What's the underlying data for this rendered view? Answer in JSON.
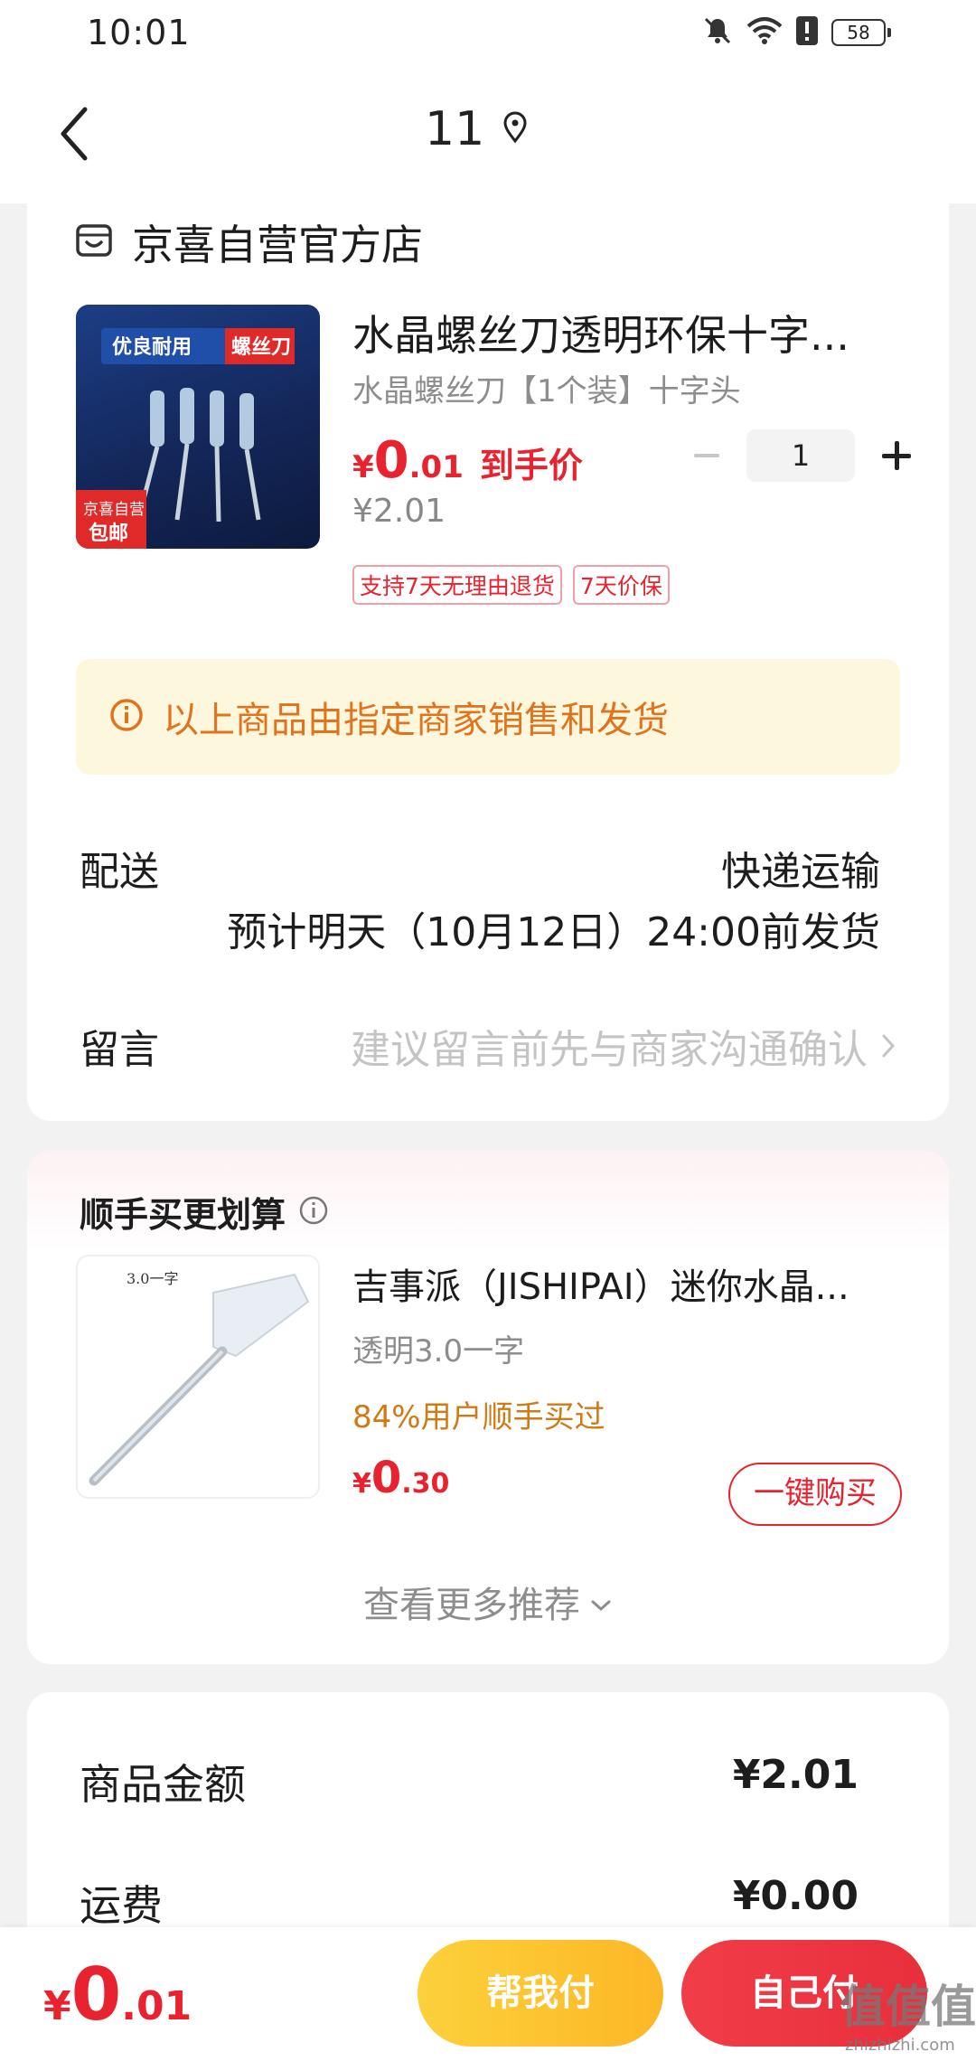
{
  "status_bar": {
    "time": "10:01",
    "battery": "58",
    "icons": [
      "mute-bell-icon",
      "wifi-icon",
      "alert-icon",
      "battery-icon"
    ]
  },
  "header": {
    "title": "11",
    "icons": [
      "back-icon",
      "location-icon"
    ]
  },
  "store": {
    "name": "京喜自营官方店"
  },
  "product": {
    "title": "水晶螺丝刀透明环保十字...",
    "spec": "水晶螺丝刀【1个装】十字头",
    "price_symbol": "¥",
    "price_int": "0",
    "price_dec": ".01",
    "price_tag": "到手价",
    "original_price": "¥2.01",
    "quantity": "1",
    "tags": [
      "支持7天无理由退货",
      "7天价保"
    ],
    "image": {
      "banner_left": "优良耐用",
      "banner_right": "螺丝刀",
      "badge_top": "京喜自营",
      "badge_bottom": "包邮"
    }
  },
  "notice": {
    "text": "以上商品由指定商家销售和发货"
  },
  "delivery": {
    "label": "配送",
    "method": "快递运输",
    "estimate": "预计明天（10月12日）24:00前发货"
  },
  "message": {
    "label": "留言",
    "placeholder": "建议留言前先与商家沟通确认"
  },
  "recommend": {
    "title": "顺手买更划算",
    "item": {
      "name": "吉事派（JISHIPAI）迷你水晶...",
      "spec": "透明3.0一字",
      "social": "84%用户顺手买过",
      "price_symbol": "¥",
      "price_int": "0",
      "price_dec": ".30",
      "buy_label": "一键购买",
      "image_label": "3.0一字"
    },
    "more": "查看更多推荐"
  },
  "summary": {
    "goods_label": "商品金额",
    "goods_value": "¥2.01",
    "shipping_label": "运费",
    "shipping_value": "¥0.00"
  },
  "bottom": {
    "total_symbol": "¥",
    "total_int": "0",
    "total_dec": ".01",
    "help_pay": "帮我付",
    "self_pay": "自己付"
  },
  "watermark": {
    "main": "值值值",
    "sub": "zhizhizhi.com"
  },
  "colors": {
    "accent_red": "#e8232f",
    "notice_bg": "#fdf7dd",
    "notice_text": "#e0731c",
    "help_btn": "#fcc530",
    "social_orange": "#d07a16"
  }
}
